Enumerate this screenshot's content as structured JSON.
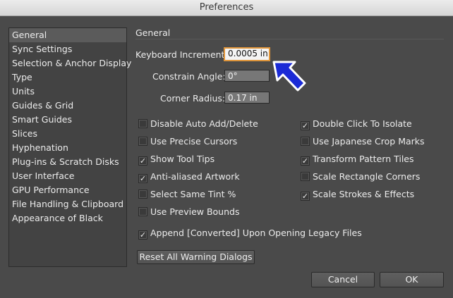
{
  "window": {
    "title": "Preferences"
  },
  "sidebar": {
    "items": [
      {
        "label": "General",
        "selected": true
      },
      {
        "label": "Sync Settings"
      },
      {
        "label": "Selection & Anchor Display"
      },
      {
        "label": "Type"
      },
      {
        "label": "Units"
      },
      {
        "label": "Guides & Grid"
      },
      {
        "label": "Smart Guides"
      },
      {
        "label": "Slices"
      },
      {
        "label": "Hyphenation"
      },
      {
        "label": "Plug-ins & Scratch Disks"
      },
      {
        "label": "User Interface"
      },
      {
        "label": "GPU Performance"
      },
      {
        "label": "File Handling & Clipboard"
      },
      {
        "label": "Appearance of Black"
      }
    ]
  },
  "general": {
    "title": "General",
    "keyboard_increment": {
      "label": "Keyboard Increment:",
      "value": "0.0005 in"
    },
    "constrain_angle": {
      "label": "Constrain Angle:",
      "value": "0°"
    },
    "corner_radius": {
      "label": "Corner Radius:",
      "value": "0.17 in"
    },
    "options_left": [
      {
        "label": "Disable Auto Add/Delete",
        "checked": false
      },
      {
        "label": "Use Precise Cursors",
        "checked": false
      },
      {
        "label": "Show Tool Tips",
        "checked": true
      },
      {
        "label": "Anti-aliased Artwork",
        "checked": true
      },
      {
        "label": "Select Same Tint %",
        "checked": false
      },
      {
        "label": "Use Preview Bounds",
        "checked": false
      }
    ],
    "options_right": [
      {
        "label": "Double Click To Isolate",
        "checked": true
      },
      {
        "label": "Use Japanese Crop Marks",
        "checked": false
      },
      {
        "label": "Transform Pattern Tiles",
        "checked": true
      },
      {
        "label": "Scale Rectangle Corners",
        "checked": false
      },
      {
        "label": "Scale Strokes & Effects",
        "checked": true
      }
    ],
    "append_converted": {
      "label": "Append [Converted] Upon Opening Legacy Files",
      "checked": true
    },
    "reset_button": "Reset All Warning Dialogs"
  },
  "buttons": {
    "cancel": "Cancel",
    "ok": "OK"
  },
  "colors": {
    "focus_ring": "#e0953a",
    "pointer_arrow": "#1a2ad6"
  },
  "icons": {
    "checkmark": "✓",
    "pointer": "pointer-arrow-icon"
  }
}
